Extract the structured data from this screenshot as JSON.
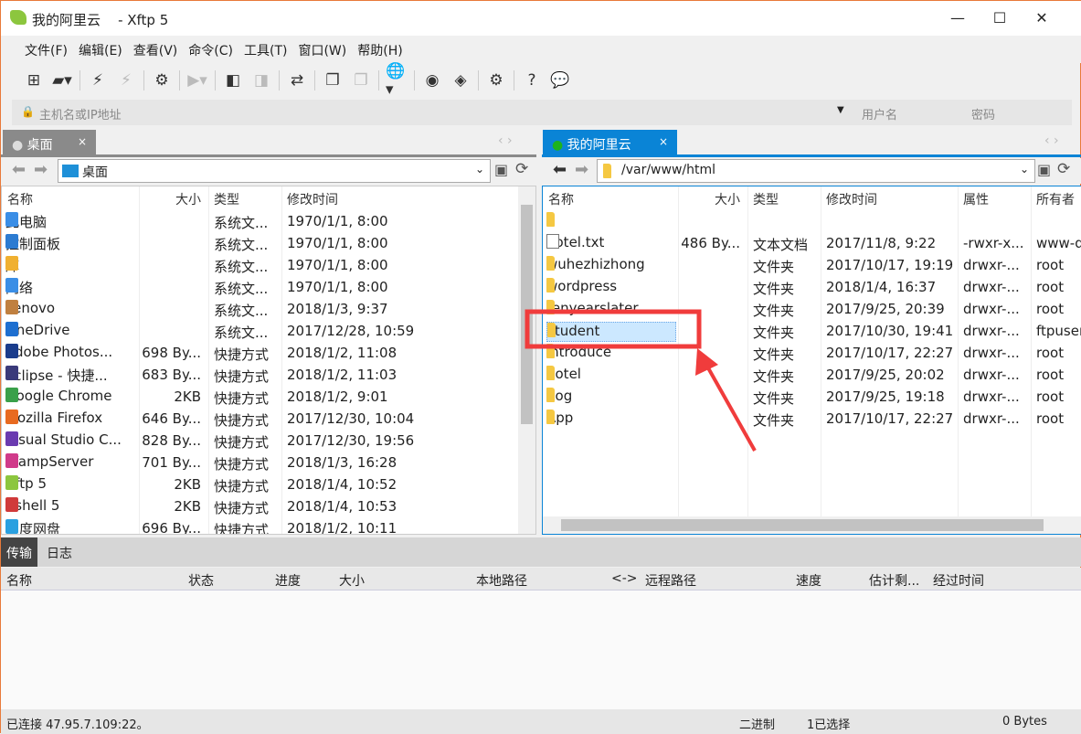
{
  "window": {
    "title": "我的阿里云    - Xftp 5",
    "minimize": "—",
    "maximize": "☐",
    "close": "✕"
  },
  "menu": [
    "文件(F)",
    "编辑(E)",
    "查看(V)",
    "命令(C)",
    "工具(T)",
    "窗口(W)",
    "帮助(H)"
  ],
  "toolbar": [
    {
      "icon": "new-session-icon",
      "glyph": "⊞",
      "enabled": true
    },
    {
      "icon": "open-folder-icon",
      "glyph": "▰▾",
      "enabled": true
    },
    {
      "sep": true
    },
    {
      "icon": "connect-icon",
      "glyph": "⚡",
      "enabled": true
    },
    {
      "icon": "disconnect-icon",
      "glyph": "⚡",
      "enabled": false
    },
    {
      "sep": true
    },
    {
      "icon": "session-properties-icon",
      "glyph": "⚙",
      "enabled": true
    },
    {
      "sep": true
    },
    {
      "icon": "transfer-start-icon",
      "glyph": "▶▾",
      "enabled": false
    },
    {
      "sep": true
    },
    {
      "icon": "download-icon",
      "glyph": "◧",
      "enabled": true
    },
    {
      "icon": "upload-icon",
      "glyph": "◨",
      "enabled": false
    },
    {
      "sep": true
    },
    {
      "icon": "sync-icon",
      "glyph": "⇄",
      "enabled": true
    },
    {
      "sep": true
    },
    {
      "icon": "copy-icon",
      "glyph": "❐",
      "enabled": true
    },
    {
      "icon": "paste-icon",
      "glyph": "❐",
      "enabled": false
    },
    {
      "sep": true
    },
    {
      "icon": "globe-icon",
      "glyph": "🌐▾",
      "enabled": true
    },
    {
      "sep": true
    },
    {
      "icon": "xshell-icon",
      "glyph": "◉",
      "enabled": true
    },
    {
      "icon": "xftp-icon",
      "glyph": "◈",
      "enabled": true
    },
    {
      "sep": true
    },
    {
      "icon": "settings-gear-icon",
      "glyph": "⚙",
      "enabled": true
    },
    {
      "sep": true
    },
    {
      "icon": "help-icon",
      "glyph": "?",
      "enabled": true
    },
    {
      "icon": "feedback-icon",
      "glyph": "💬",
      "enabled": true
    }
  ],
  "address": {
    "host_placeholder": "主机名或IP地址",
    "user_placeholder": "用户名",
    "password_placeholder": "密码"
  },
  "left": {
    "tab": "桌面",
    "tab_close": "×",
    "path": "桌面",
    "columns": [
      "名称",
      "大小",
      "类型",
      "修改时间"
    ],
    "rows": [
      [
        "此电脑",
        "",
        "系统文...",
        "1970/1/1, 8:00"
      ],
      [
        "控制面板",
        "",
        "系统文...",
        "1970/1/1, 8:00"
      ],
      [
        "库",
        "",
        "系统文...",
        "1970/1/1, 8:00"
      ],
      [
        "网络",
        "",
        "系统文...",
        "1970/1/1, 8:00"
      ],
      [
        "Lenovo",
        "",
        "系统文...",
        "2018/1/3, 9:37"
      ],
      [
        "OneDrive",
        "",
        "系统文...",
        "2017/12/28, 10:59"
      ],
      [
        "Adobe Photos...",
        "698 By...",
        "快捷方式",
        "2018/1/2, 11:08"
      ],
      [
        "eclipse - 快捷...",
        "683 By...",
        "快捷方式",
        "2018/1/2, 11:03"
      ],
      [
        "Google Chrome",
        "2KB",
        "快捷方式",
        "2018/1/2, 9:01"
      ],
      [
        "Mozilla Firefox",
        "646 By...",
        "快捷方式",
        "2017/12/30, 10:04"
      ],
      [
        "Visual Studio C...",
        "828 By...",
        "快捷方式",
        "2017/12/30, 19:56"
      ],
      [
        "WampServer",
        "701 By...",
        "快捷方式",
        "2018/1/3, 16:28"
      ],
      [
        "Xftp 5",
        "2KB",
        "快捷方式",
        "2018/1/4, 10:52"
      ],
      [
        "Xshell 5",
        "2KB",
        "快捷方式",
        "2018/1/4, 10:53"
      ],
      [
        "百度网盘",
        "696 By...",
        "快捷方式",
        "2018/1/2, 10:11"
      ]
    ]
  },
  "right": {
    "tab": "我的阿里云",
    "tab_close": "×",
    "status_color": "#1db31d",
    "accent": "#0a84d6",
    "path": "/var/www/html",
    "columns": [
      "名称",
      "大小",
      "类型",
      "修改时间",
      "属性",
      "所有者"
    ],
    "rows": [
      [
        "..",
        "",
        "",
        "",
        "",
        ""
      ],
      [
        "hotel.txt",
        "486 By...",
        "文本文档",
        "2017/11/8, 9:22",
        "-rwxr-x...",
        "www-d"
      ],
      [
        "wuhezhizhong",
        "",
        "文件夹",
        "2017/10/17, 19:19",
        "drwxr-...",
        "root"
      ],
      [
        "wordpress",
        "",
        "文件夹",
        "2018/1/4, 16:37",
        "drwxr-...",
        "root"
      ],
      [
        "tenyearslater",
        "",
        "文件夹",
        "2017/9/25, 20:39",
        "drwxr-...",
        "root"
      ],
      [
        "student",
        "",
        "文件夹",
        "2017/10/30, 19:41",
        "drwxr-...",
        "ftpuser"
      ],
      [
        "introduce",
        "",
        "文件夹",
        "2017/10/17, 22:27",
        "drwxr-...",
        "root"
      ],
      [
        "hotel",
        "",
        "文件夹",
        "2017/9/25, 20:02",
        "drwxr-...",
        "root"
      ],
      [
        "dog",
        "",
        "文件夹",
        "2017/9/25, 19:18",
        "drwxr-...",
        "root"
      ],
      [
        "App",
        "",
        "文件夹",
        "2017/10/17, 22:27",
        "drwxr-...",
        "root"
      ]
    ],
    "selected": "student"
  },
  "transfer": {
    "tabs": [
      "传输",
      "日志"
    ],
    "columns": [
      "名称",
      "状态",
      "进度",
      "大小",
      "本地路径",
      "<->",
      "远程路径",
      "速度",
      "估计剩...",
      "经过时间"
    ]
  },
  "status": {
    "connection": "已连接 47.95.7.109:22。",
    "mode": "二进制",
    "selected": "1已选择",
    "size": "0 Bytes"
  },
  "annotation_color": "#f03c3c"
}
